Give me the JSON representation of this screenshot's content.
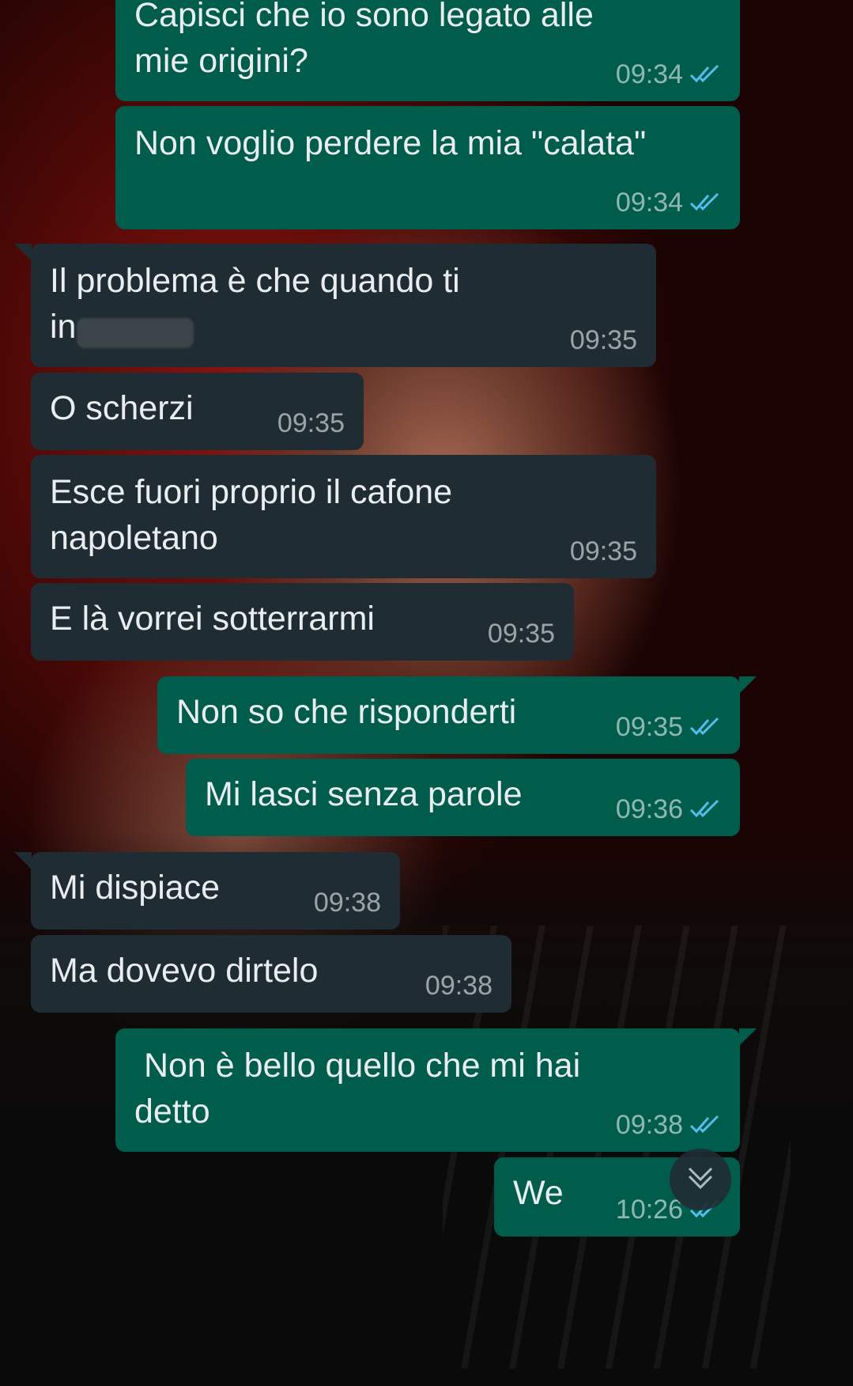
{
  "messages": [
    {
      "text": "Capisci che io sono legato alle\nmie origini?",
      "time": "09:34",
      "direction": "outgoing",
      "status": "read"
    },
    {
      "text": "Non voglio perdere la mia \"calata\"",
      "time": "09:34",
      "direction": "outgoing",
      "status": "read"
    },
    {
      "text": "Il problema è che quando ti\nin",
      "time": "09:35",
      "direction": "incoming"
    },
    {
      "text": "O scherzi",
      "time": "09:35",
      "direction": "incoming"
    },
    {
      "text": "Esce fuori proprio il cafone\nnapoletano",
      "time": "09:35",
      "direction": "incoming"
    },
    {
      "text": "E là vorrei sotterrarmi",
      "time": "09:35",
      "direction": "incoming"
    },
    {
      "text": "Non so che risponderti",
      "time": "09:35",
      "direction": "outgoing",
      "status": "read"
    },
    {
      "text": "Mi lasci senza parole",
      "time": "09:36",
      "direction": "outgoing",
      "status": "read"
    },
    {
      "text": "Mi dispiace",
      "time": "09:38",
      "direction": "incoming"
    },
    {
      "text": "Ma dovevo dirtelo",
      "time": "09:38",
      "direction": "incoming"
    },
    {
      "text": " Non è bello quello che mi hai\ndetto",
      "time": "09:38",
      "direction": "outgoing",
      "status": "read"
    },
    {
      "text": "We",
      "time": "10:26",
      "direction": "outgoing",
      "status": "read"
    }
  ],
  "icons": {
    "read_receipt": "double-check-icon",
    "scroll_button": "chevron-double-down-icon"
  },
  "colors": {
    "outgoing_bubble": "#005c4b",
    "incoming_bubble": "#202c33",
    "read_tick": "#53bdeb",
    "text": "#e9edef"
  }
}
